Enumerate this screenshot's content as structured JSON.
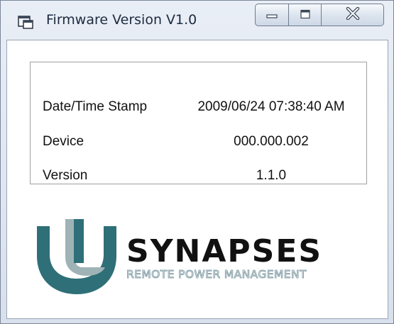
{
  "window": {
    "title": "Firmware Version V1.0",
    "icon": "window-app-icon",
    "caption_buttons": [
      "minimize-icon",
      "maximize-icon",
      "close-icon"
    ]
  },
  "info": {
    "rows": [
      {
        "label": "Date/Time Stamp",
        "value": "2009/06/24 07:38:40 AM"
      },
      {
        "label": "Device",
        "value": "000.000.002"
      },
      {
        "label": "Version",
        "value": "1.1.0"
      }
    ]
  },
  "branding": {
    "name": "SYNAPSES",
    "tagline": "REMOTE POWER MANAGEMENT",
    "colors": {
      "primary": "#2f6f78",
      "secondary": "#9fb3b7",
      "text": "#111111"
    }
  }
}
